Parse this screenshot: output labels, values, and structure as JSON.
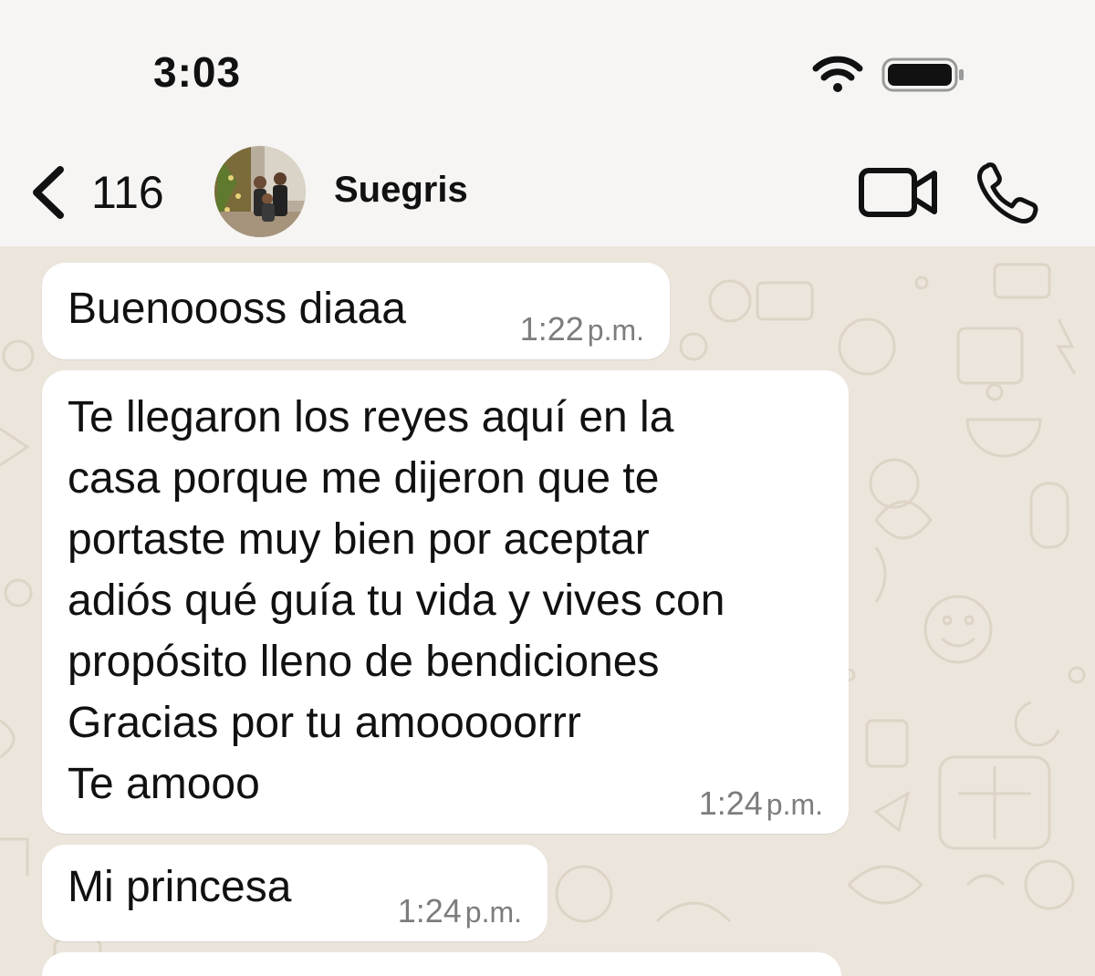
{
  "status_bar": {
    "time": "3:03"
  },
  "header": {
    "back_count": "116",
    "chat_name": "Suegris",
    "icons": {
      "back": "chevron-left-icon",
      "video": "video-camera-icon",
      "call": "phone-icon"
    }
  },
  "messages": [
    {
      "text": "Buenoooss diaaa",
      "time": "1:22",
      "ampm": "p.m."
    },
    {
      "text": "Te llegaron los reyes aquí en la\ncasa porque me dijeron que te\nportaste muy bien por aceptar\nadiós qué guía tu vida y vives con\npropósito lleno de bendiciones\nGracias por tu amooooorrr\nTe amooo",
      "time": "1:24",
      "ampm": "p.m."
    },
    {
      "text": "Mi princesa",
      "time": "1:24",
      "ampm": "p.m."
    }
  ],
  "colors": {
    "background": "#f6f5f3",
    "chat_wallpaper": "#ece5dc",
    "bubble": "#ffffff",
    "timestamp": "#7d7d7d"
  }
}
